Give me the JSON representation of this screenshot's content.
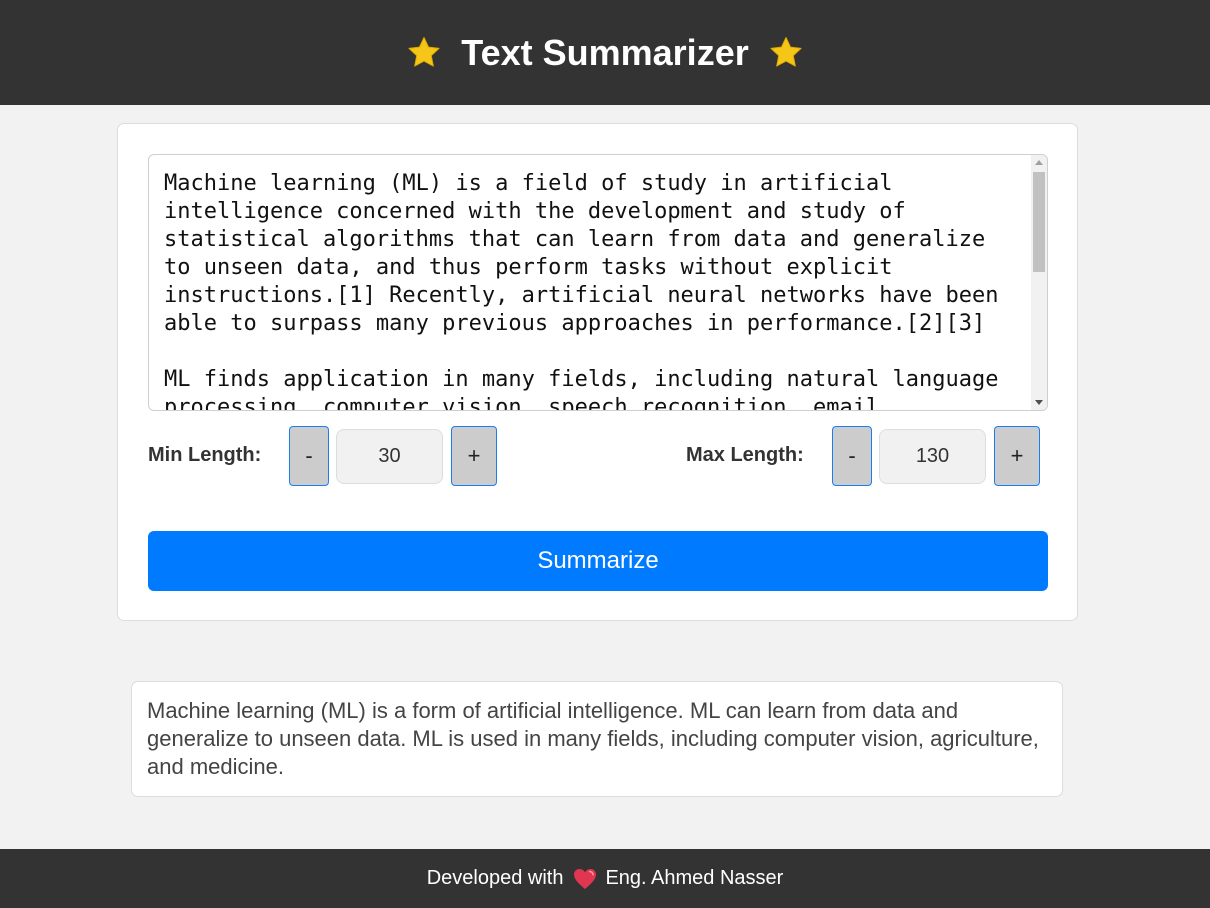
{
  "header": {
    "title": "Text Summarizer",
    "left_icon": "star-icon",
    "right_icon": "star-icon",
    "bg_color": "#333333",
    "star_color": "#f5c518"
  },
  "input": {
    "text": "Machine learning (ML) is a field of study in artificial\nintelligence concerned with the development and study of\nstatistical algorithms that can learn from data and generalize\nto unseen data, and thus perform tasks without explicit\ninstructions.[1] Recently, artificial neural networks have been\nable to surpass many previous approaches in performance.[2][3]\n\nML finds application in many fields, including natural language\nprocessing, computer vision, speech recognition, email"
  },
  "controls": {
    "min_label": "Min Length:",
    "min_value": "30",
    "max_label": "Max Length:",
    "max_value": "130",
    "decrement_label": "-",
    "increment_label": "+"
  },
  "summarize_button": {
    "label": "Summarize",
    "color": "#007bff"
  },
  "output": {
    "text": "Machine learning (ML) is a form of artificial intelligence. ML can learn from data and generalize to unseen data. ML is used in many fields, including computer vision, agriculture, and medicine."
  },
  "footer": {
    "prefix": "Developed with",
    "icon": "heart-icon",
    "author": "Eng. Ahmed Nasser"
  }
}
